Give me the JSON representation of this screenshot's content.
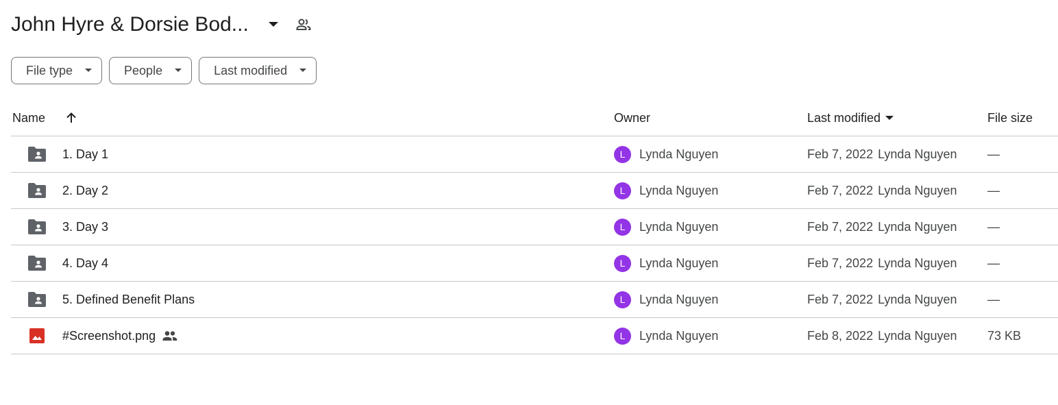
{
  "header": {
    "title": "John Hyre & Dorsie Bod...",
    "title_menu_icon": "caret-down-icon",
    "shared_icon": "shared-people-icon"
  },
  "filters": [
    {
      "label": "File type",
      "icon": "caret-down-icon"
    },
    {
      "label": "People",
      "icon": "caret-down-icon"
    },
    {
      "label": "Last modified",
      "icon": "caret-down-icon"
    }
  ],
  "columns": {
    "name": "Name",
    "name_sort_icon": "arrow-up-icon",
    "owner": "Owner",
    "last_modified": "Last modified",
    "last_modified_sort_icon": "caret-down-icon",
    "file_size": "File size"
  },
  "rows": [
    {
      "icon": "shared-folder-icon",
      "name": "1. Day 1",
      "owner_initial": "L",
      "owner": "Lynda Nguyen",
      "modified_date": "Feb 7, 2022",
      "modified_by": "Lynda Nguyen",
      "size": "—"
    },
    {
      "icon": "shared-folder-icon",
      "name": "2. Day 2",
      "owner_initial": "L",
      "owner": "Lynda Nguyen",
      "modified_date": "Feb 7, 2022",
      "modified_by": "Lynda Nguyen",
      "size": "—"
    },
    {
      "icon": "shared-folder-icon",
      "name": "3. Day 3",
      "owner_initial": "L",
      "owner": "Lynda Nguyen",
      "modified_date": "Feb 7, 2022",
      "modified_by": "Lynda Nguyen",
      "size": "—"
    },
    {
      "icon": "shared-folder-icon",
      "name": "4. Day 4",
      "owner_initial": "L",
      "owner": "Lynda Nguyen",
      "modified_date": "Feb 7, 2022",
      "modified_by": "Lynda Nguyen",
      "size": "—"
    },
    {
      "icon": "shared-folder-icon",
      "name": "5. Defined Benefit Plans",
      "owner_initial": "L",
      "owner": "Lynda Nguyen",
      "modified_date": "Feb 7, 2022",
      "modified_by": "Lynda Nguyen",
      "size": "—"
    },
    {
      "icon": "image-file-icon",
      "name": "#Screenshot.png",
      "shared": true,
      "owner_initial": "L",
      "owner": "Lynda Nguyen",
      "modified_date": "Feb 8, 2022",
      "modified_by": "Lynda Nguyen",
      "size": "73 KB"
    }
  ],
  "colors": {
    "avatar": "#9334e6",
    "folder_icon": "#5f6368",
    "image_icon": "#d93025",
    "divider": "#c7c7c7"
  }
}
